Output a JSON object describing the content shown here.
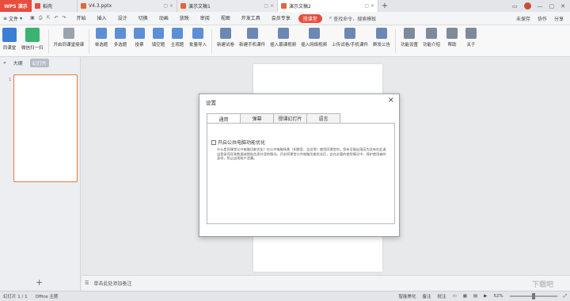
{
  "tabs": {
    "logo": "WPS 演示",
    "items": [
      {
        "label": "稻壳",
        "color": "#e84d3d",
        "active": false
      },
      {
        "label": "V4.3.pptx",
        "color": "#e0663a",
        "active": false
      },
      {
        "label": "演示文稿1",
        "color": "#e0663a",
        "active": false
      },
      {
        "label": "演示文稿2",
        "color": "#e0663a",
        "active": true
      }
    ],
    "add": "+"
  },
  "menu": {
    "file": "文件",
    "items": [
      "开始",
      "插入",
      "设计",
      "切换",
      "动画",
      "放映",
      "审阅",
      "视图",
      "开发工具",
      "会员专享"
    ],
    "highlight": "授课堂",
    "search": "查找命令、搜索模板",
    "right": [
      "未保存",
      "协作",
      "分享"
    ]
  },
  "ribbon": [
    {
      "label": "同课堂",
      "color": "#3b7fd4",
      "big": true
    },
    {
      "label": "微信扫一扫",
      "color": "#3cb371",
      "big": true
    },
    {
      "label": "开启同课堂授课",
      "color": "#9aa3ad"
    },
    {
      "label": "单选题",
      "color": "#5c8fd6"
    },
    {
      "label": "多选题",
      "color": "#5c8fd6"
    },
    {
      "label": "投票",
      "color": "#5c8fd6"
    },
    {
      "label": "填空题",
      "color": "#5c8fd6"
    },
    {
      "label": "主观题",
      "color": "#5c8fd6"
    },
    {
      "label": "批量导入",
      "color": "#5c8fd6"
    },
    {
      "label": "新建试卷",
      "color": "#6c87b3"
    },
    {
      "label": "新建手机课件",
      "color": "#6c87b3"
    },
    {
      "label": "插入慕课视频",
      "color": "#6c87b3"
    },
    {
      "label": "插入网络视频",
      "color": "#6c87b3"
    },
    {
      "label": "上传试卷/手机课件",
      "color": "#6c87b3"
    },
    {
      "label": "群发公告",
      "color": "#6c87b3"
    },
    {
      "label": "功能设置",
      "color": "#7d8a99"
    },
    {
      "label": "功能介绍",
      "color": "#7d8a99"
    },
    {
      "label": "帮助",
      "color": "#7d8a99"
    },
    {
      "label": "关于",
      "color": "#7d8a99"
    }
  ],
  "leftpanel": {
    "tab_outline": "大纲",
    "tab_slides": "幻灯片",
    "slide_num": "1",
    "add": "+"
  },
  "notes": {
    "placeholder": "单击此处添加备注"
  },
  "status": {
    "slide": "幻灯片 1 / 1",
    "theme": "Office 主题",
    "beautify": "智能美化",
    "notes": "备注",
    "comment": "批注",
    "zoom": "52%"
  },
  "dialog": {
    "title": "设置",
    "close": "×",
    "tabs": [
      "通用",
      "弹幕",
      "授课幻灯片",
      "语言"
    ],
    "checkbox_label": "开启公共电脑功能优化",
    "description": "什么是同课堂公共电脑功能优化？在公共电脑场景（如教室、会议等）使用同课堂时，您有可能出现因为没有在此退出登录而导致数据或隐私信息外泄的情况。开启同课堂公共电脑功能优化后，会在必要的使用情况中，保护使用者的身份，防止出现账户泄漏。"
  },
  "watermark": "下载吧"
}
